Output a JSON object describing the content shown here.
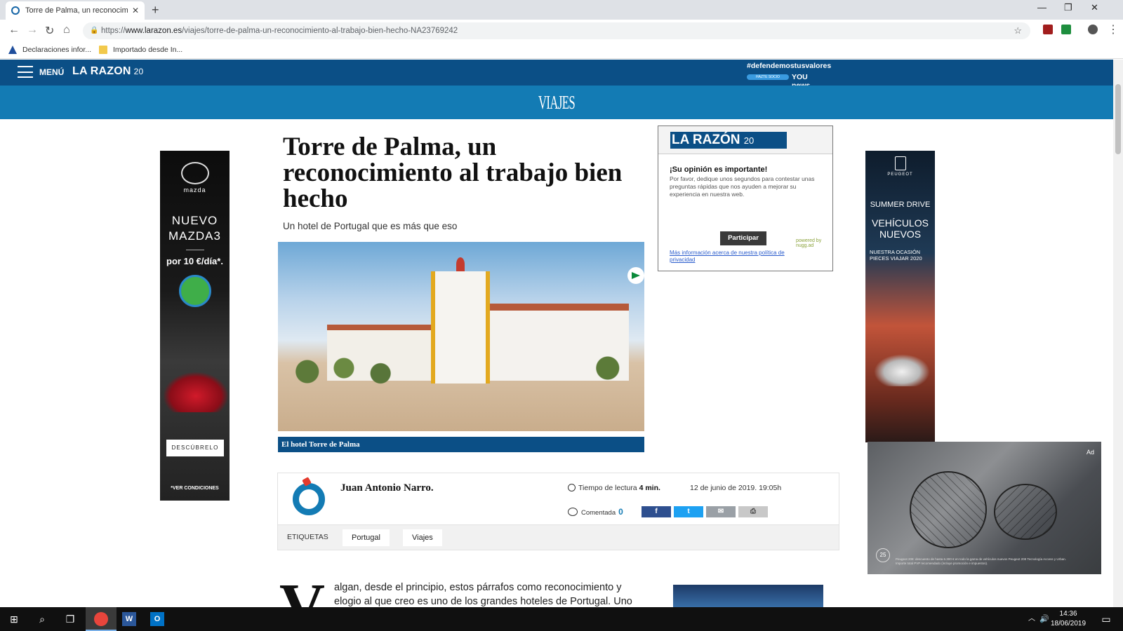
{
  "browser": {
    "tab_title": "Torre de Palma, un reconocimien",
    "url_prefix": "https://",
    "url_host": "www.larazon.es",
    "url_path": "/viajes/torre-de-palma-un-reconocimiento-al-trabajo-bien-hecho-NA23769242",
    "bookmarks": [
      "Declaraciones infor...",
      "Importado desde In..."
    ]
  },
  "site": {
    "menu_label": "MENÚ",
    "logo_text": "LA RAZON",
    "logo_suffix": "20",
    "hashtag": "#defendemostusvalores",
    "pill_text": "HAZTE SOCIO",
    "you_text": "YOU news",
    "section_title": "VIAJES"
  },
  "article": {
    "title": "Torre de Palma, un reconocimiento al trabajo bien hecho",
    "subtitle": "Un hotel de Portugal que es más que eso",
    "photo_caption": "El hotel Torre de Palma",
    "author": "Juan Antonio Narro.",
    "read_time_label": "Tiempo de lectura",
    "read_time_value": "4 min.",
    "published": "12 de junio de 2019. 19:05h",
    "comments_label": "Comentada",
    "comments_count": "0",
    "share": {
      "facebook": "f",
      "twitter": "t",
      "email": "✉",
      "print": "⎙"
    },
    "tags_label": "ETIQUETAS",
    "tags": [
      "Portugal",
      "Viajes"
    ],
    "dropcap": "V",
    "body_text": "algan, desde el principio, estos párrafos como reconocimiento y elogio al que creo es uno de los grandes hoteles de Portugal. Uno"
  },
  "survey": {
    "logo": "LA RAZÓN",
    "logo_suffix": "20",
    "question": "¡Su opinión es importante!",
    "description": "Por favor, dedique unos segundos para contestar unas preguntas rápidas que nos ayuden a mejorar su experiencia en nuestra web.",
    "button": "Participar",
    "powered": "powered by nugg.ad",
    "policy_link": "Más información acerca de nuestra política de privacidad"
  },
  "ads": {
    "left": {
      "brand": "mazda",
      "headline_1": "NUEVO",
      "headline_2": "MAZDA3",
      "price": "por 10 €/día*.",
      "cta": "DESCÚBRELO",
      "conditions": "*VER CONDICIONES"
    },
    "right": {
      "brand": "PEUGEOT",
      "line_1": "SUMMER DRIVE",
      "line_2": "VEHÍCULOS NUEVOS",
      "small_text": "NUESTRA OCASIÓN PIECES VIAJAR 2020"
    },
    "video": {
      "label": "Ad",
      "timer": "25",
      "fine_print": "Peugeot 208: descuento de hasta 6.300 € en todo la gama de vehículos nuevos Peugeot 208 Tecnología Access y Urban. Importe total PVP recomendado (incluye promoción e impuestos)."
    }
  },
  "taskbar": {
    "time": "14:36",
    "date": "18/06/2019"
  },
  "colors": {
    "header_dark": "#0b4f86",
    "section_blue": "#137bb4",
    "facebook": "#2e4f8f",
    "twitter": "#1da1f2",
    "email": "#9aa0a6",
    "print": "#c8c8c8"
  }
}
